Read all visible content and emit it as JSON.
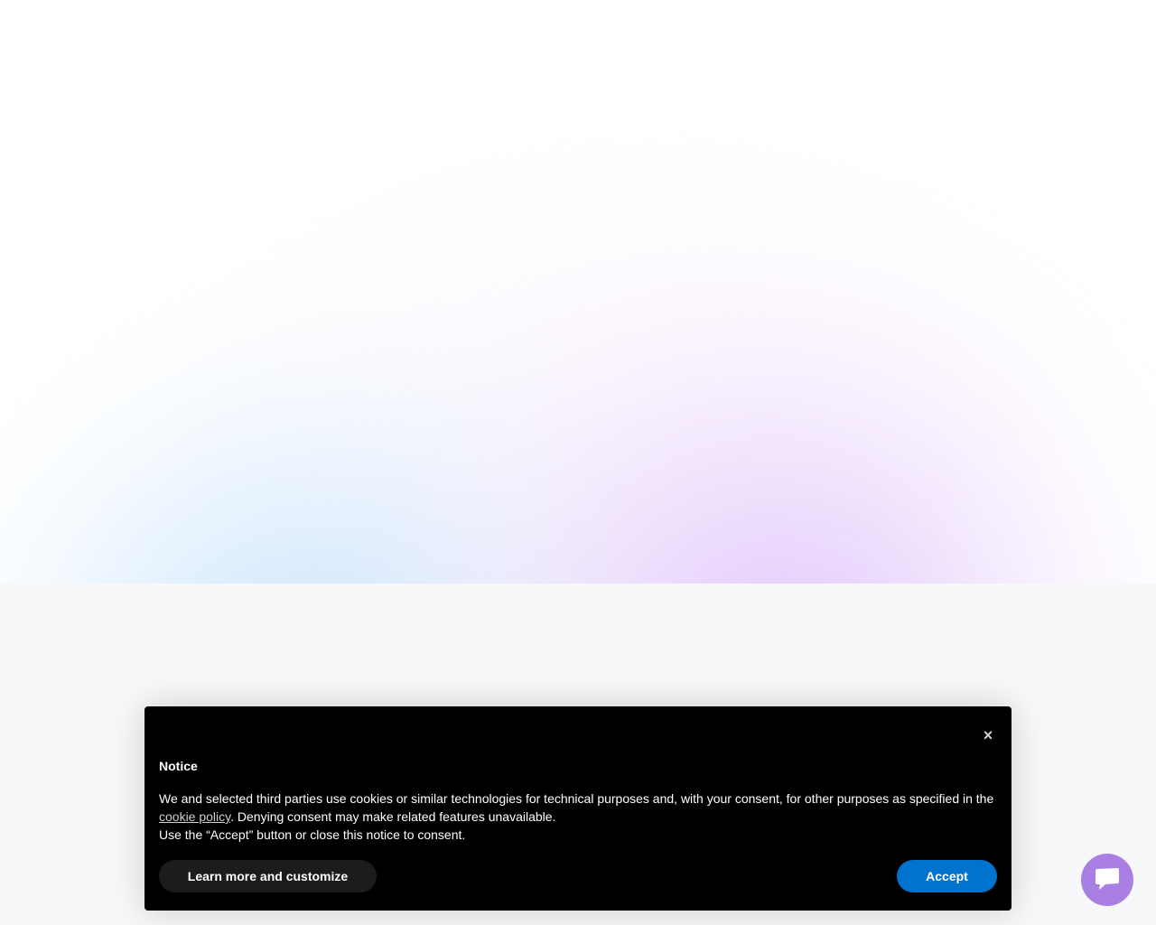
{
  "cookie_notice": {
    "title": "Notice",
    "body_before_link": "We and selected third parties use cookies or similar technologies for technical purposes and, with your consent, for other purposes as specified in the ",
    "link_text": "cookie policy",
    "body_after_link": ". Denying consent may make related features unavailable.",
    "body_line2": "Use the “Accept” button or close this notice to consent.",
    "close_label": "×",
    "customize_label": "Learn more and customize",
    "accept_label": "Accept"
  },
  "chat": {
    "icon": "chat-bubble-icon"
  },
  "colors": {
    "accept_button": "#0073ce",
    "chat_launcher": "#a97fe4",
    "banner_background": "#000000"
  }
}
